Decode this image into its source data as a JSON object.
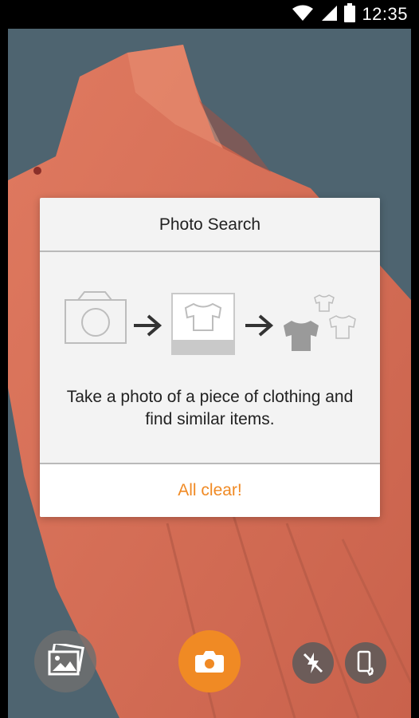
{
  "status_bar": {
    "time": "12:35",
    "icons": [
      "wifi-icon",
      "signal-icon",
      "battery-icon"
    ]
  },
  "dialog": {
    "title": "Photo Search",
    "message": "Take a photo of a piece of clothing and find similar items.",
    "action_label": "All clear!",
    "illustration": [
      "camera-icon",
      "arrow-right-icon",
      "photo-shirt-icon",
      "arrow-right-icon",
      "shirt-results-icon"
    ]
  },
  "controls": {
    "gallery_icon": "gallery-icon",
    "shutter_icon": "camera-icon",
    "flash_icon": "flash-off-icon",
    "rotate_icon": "rotate-screen-icon"
  },
  "colors": {
    "accent": "#f08a24",
    "background": "#4e6470",
    "garment": "#d9755c",
    "dialog_bg": "#f3f3f3"
  }
}
